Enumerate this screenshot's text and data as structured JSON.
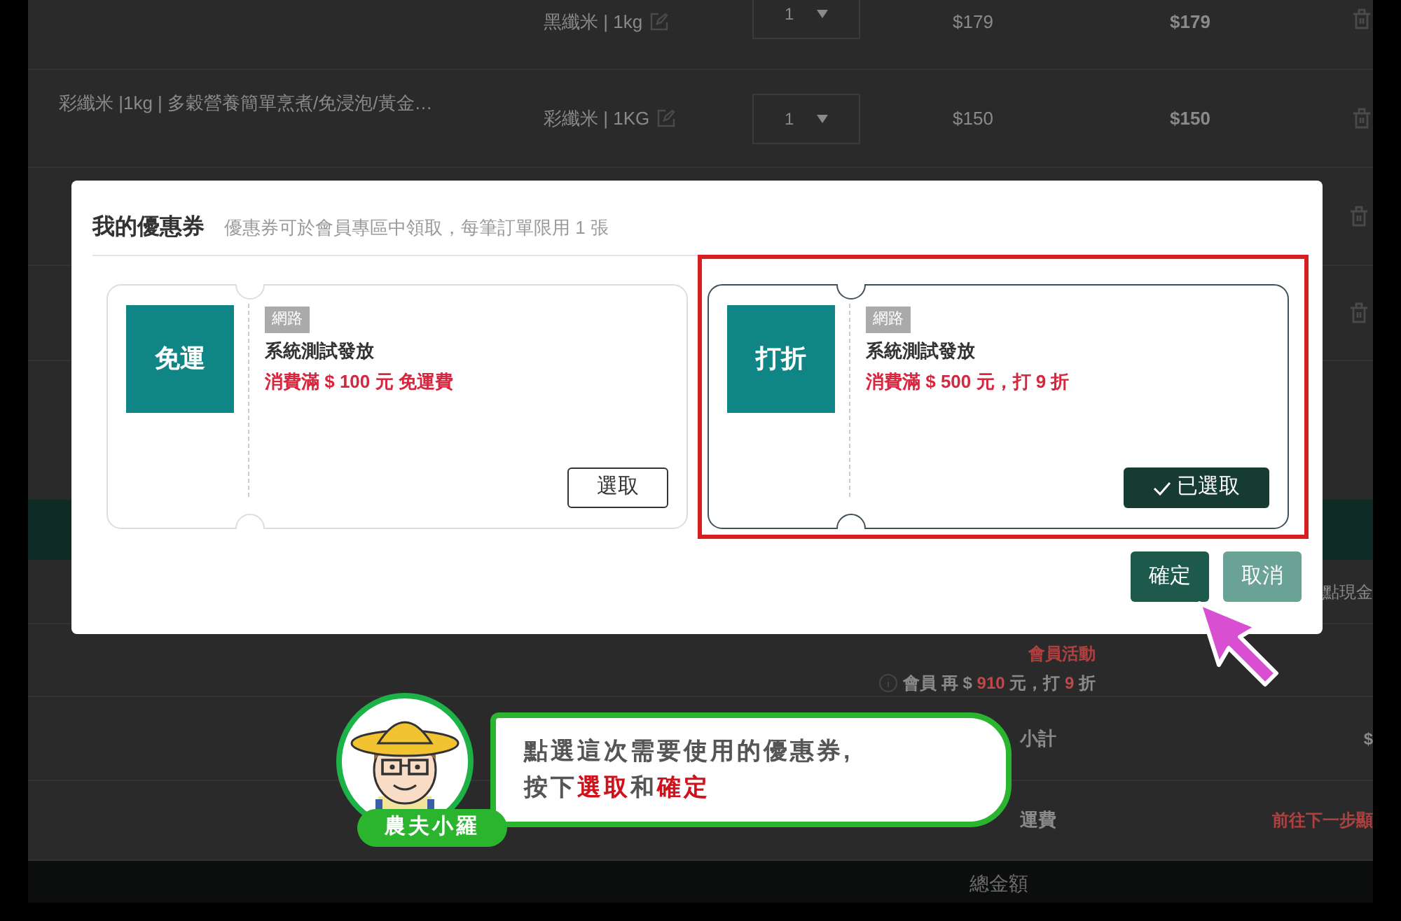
{
  "cart_rows": [
    {
      "name": "",
      "variant": "黑纖米 | 1kg",
      "quantity": "1",
      "price": "$179",
      "subtotal": "$179"
    },
    {
      "name": "彩纖米 |1kg | 多穀營養簡單烹煮/免浸泡/黃金…",
      "variant": "彩纖米 | 1KG",
      "quantity": "1",
      "price": "$150",
      "subtotal": "$150"
    }
  ],
  "points_label": "點現金",
  "member_activity": {
    "title": "會員活動",
    "parts": [
      {
        "text": "會員 再 $ ",
        "highlight": false
      },
      {
        "text": "910",
        "highlight": true
      },
      {
        "text": " 元，打 ",
        "highlight": false
      },
      {
        "text": "9",
        "highlight": true
      },
      {
        "text": " 折",
        "highlight": false
      }
    ]
  },
  "summary": [
    {
      "label": "小計",
      "value": "$"
    },
    {
      "label": "運費",
      "value": "前往下一步顯"
    }
  ],
  "total_label": "總金額",
  "dialog": {
    "title": "我的優惠券",
    "subtitle": "優惠券可於會員專區中領取，每筆訂單限用 1 張",
    "coupons": [
      {
        "type": "免運",
        "tag": "網路",
        "title": "系統測試發放",
        "condition": "消費滿 $ 100 元 免運費",
        "button": "選取",
        "selected": false,
        "highlighted": false
      },
      {
        "type": "打折",
        "tag": "網路",
        "title": "系統測試發放",
        "condition": "消費滿 $ 500 元，打 9 折",
        "button": "已選取",
        "selected": true,
        "highlighted": true
      }
    ],
    "buttons": [
      {
        "label": "確定",
        "kind": "primary"
      },
      {
        "label": "取消",
        "kind": "secondary"
      }
    ]
  },
  "guide": {
    "name": "農夫小羅",
    "lines": [
      [
        {
          "text": "點選這次需要使用的優惠券,",
          "highlight": false
        }
      ],
      [
        {
          "text": "按下",
          "highlight": false
        },
        {
          "text": "選取",
          "highlight": true
        },
        {
          "text": "和",
          "highlight": false
        },
        {
          "text": "確定",
          "highlight": true
        }
      ]
    ]
  }
}
